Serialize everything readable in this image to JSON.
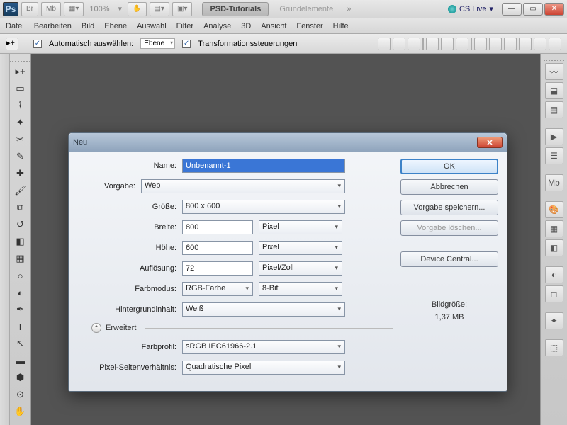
{
  "titlebar": {
    "zoom": "100%",
    "tabs": [
      "PSD-Tutorials",
      "Grundelemente"
    ],
    "cslive": "CS Live"
  },
  "menu": [
    "Datei",
    "Bearbeiten",
    "Bild",
    "Ebene",
    "Auswahl",
    "Filter",
    "Analyse",
    "3D",
    "Ansicht",
    "Fenster",
    "Hilfe"
  ],
  "options": {
    "auto": "Automatisch auswählen:",
    "layer": "Ebene",
    "trans": "Transformationssteuerungen"
  },
  "dialog": {
    "title": "Neu",
    "labels": {
      "name": "Name:",
      "preset": "Vorgabe:",
      "size": "Größe:",
      "width": "Breite:",
      "height": "Höhe:",
      "resolution": "Auflösung:",
      "colormode": "Farbmodus:",
      "bgcontent": "Hintergrundinhalt:",
      "advanced": "Erweitert",
      "colorprofile": "Farbprofil:",
      "pixelaspect": "Pixel-Seitenverhältnis:"
    },
    "values": {
      "name": "Unbenannt-1",
      "preset": "Web",
      "size": "800 x 600",
      "width": "800",
      "height": "600",
      "resolution": "72",
      "colormode": "RGB-Farbe",
      "bitdepth": "8-Bit",
      "bgcontent": "Weiß",
      "colorprofile": "sRGB IEC61966-2.1",
      "pixelaspect": "Quadratische Pixel",
      "unit_px": "Pixel",
      "unit_ppi": "Pixel/Zoll"
    },
    "buttons": {
      "ok": "OK",
      "cancel": "Abbrechen",
      "savepreset": "Vorgabe speichern...",
      "deletepreset": "Vorgabe löschen...",
      "devicecentral": "Device Central..."
    },
    "imagesize_label": "Bildgröße:",
    "imagesize_value": "1,37 MB"
  }
}
